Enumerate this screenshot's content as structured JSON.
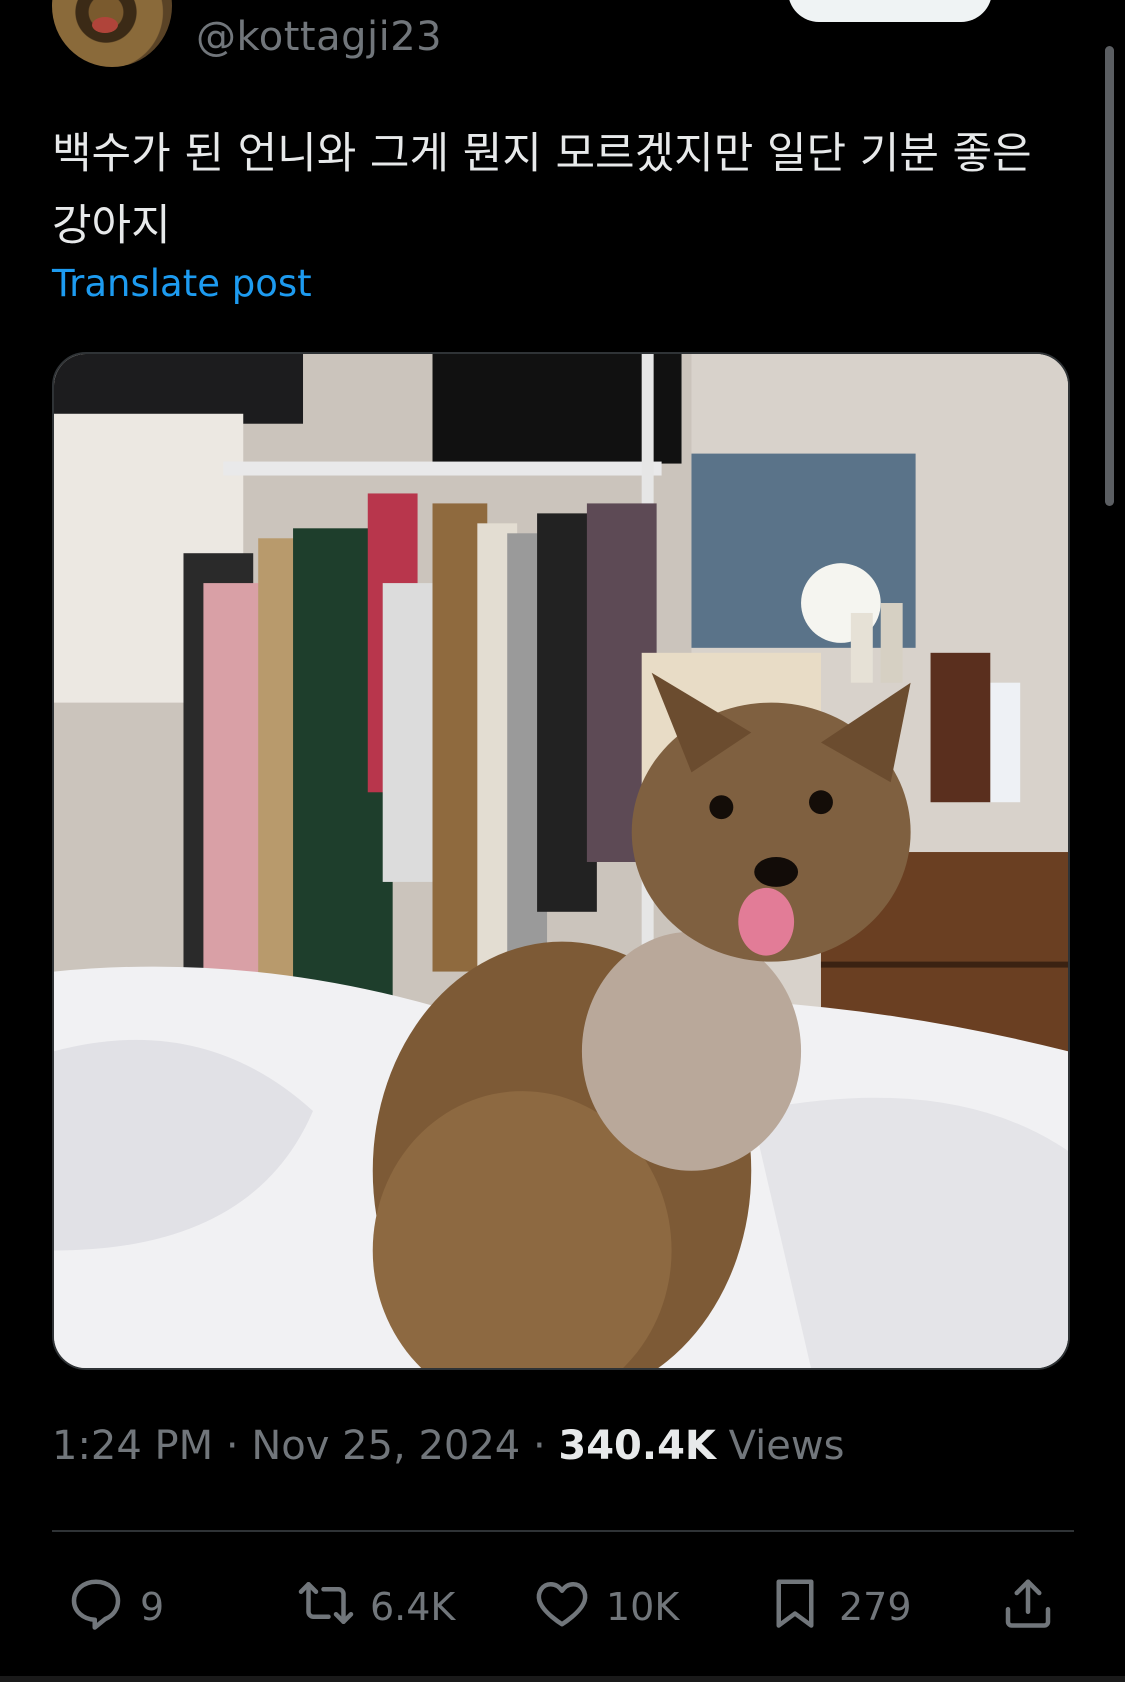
{
  "tweet": {
    "handle": "@kottagji23",
    "text": "백수가 된 언니와 그게 뭔지 모르겠지만 일단 기분 좋은 강아지",
    "translate_label": "Translate post",
    "time": "1:24 PM",
    "date": "Nov 25, 2024",
    "separator": "·",
    "views_count": "340.4K",
    "views_label": "Views",
    "media": {
      "icon": "photo-dog-on-bed"
    }
  },
  "actions": {
    "reply": {
      "icon": "reply-icon",
      "count": "9"
    },
    "repost": {
      "icon": "repost-icon",
      "count": "6.4K"
    },
    "like": {
      "icon": "heart-icon",
      "count": "10K"
    },
    "bookmark": {
      "icon": "bookmark-icon",
      "count": "279"
    },
    "share": {
      "icon": "share-icon"
    }
  },
  "colors": {
    "background": "#000000",
    "text": "#e7e9ea",
    "muted": "#71767b",
    "link": "#1d9bf0",
    "divider": "#2f3336"
  }
}
